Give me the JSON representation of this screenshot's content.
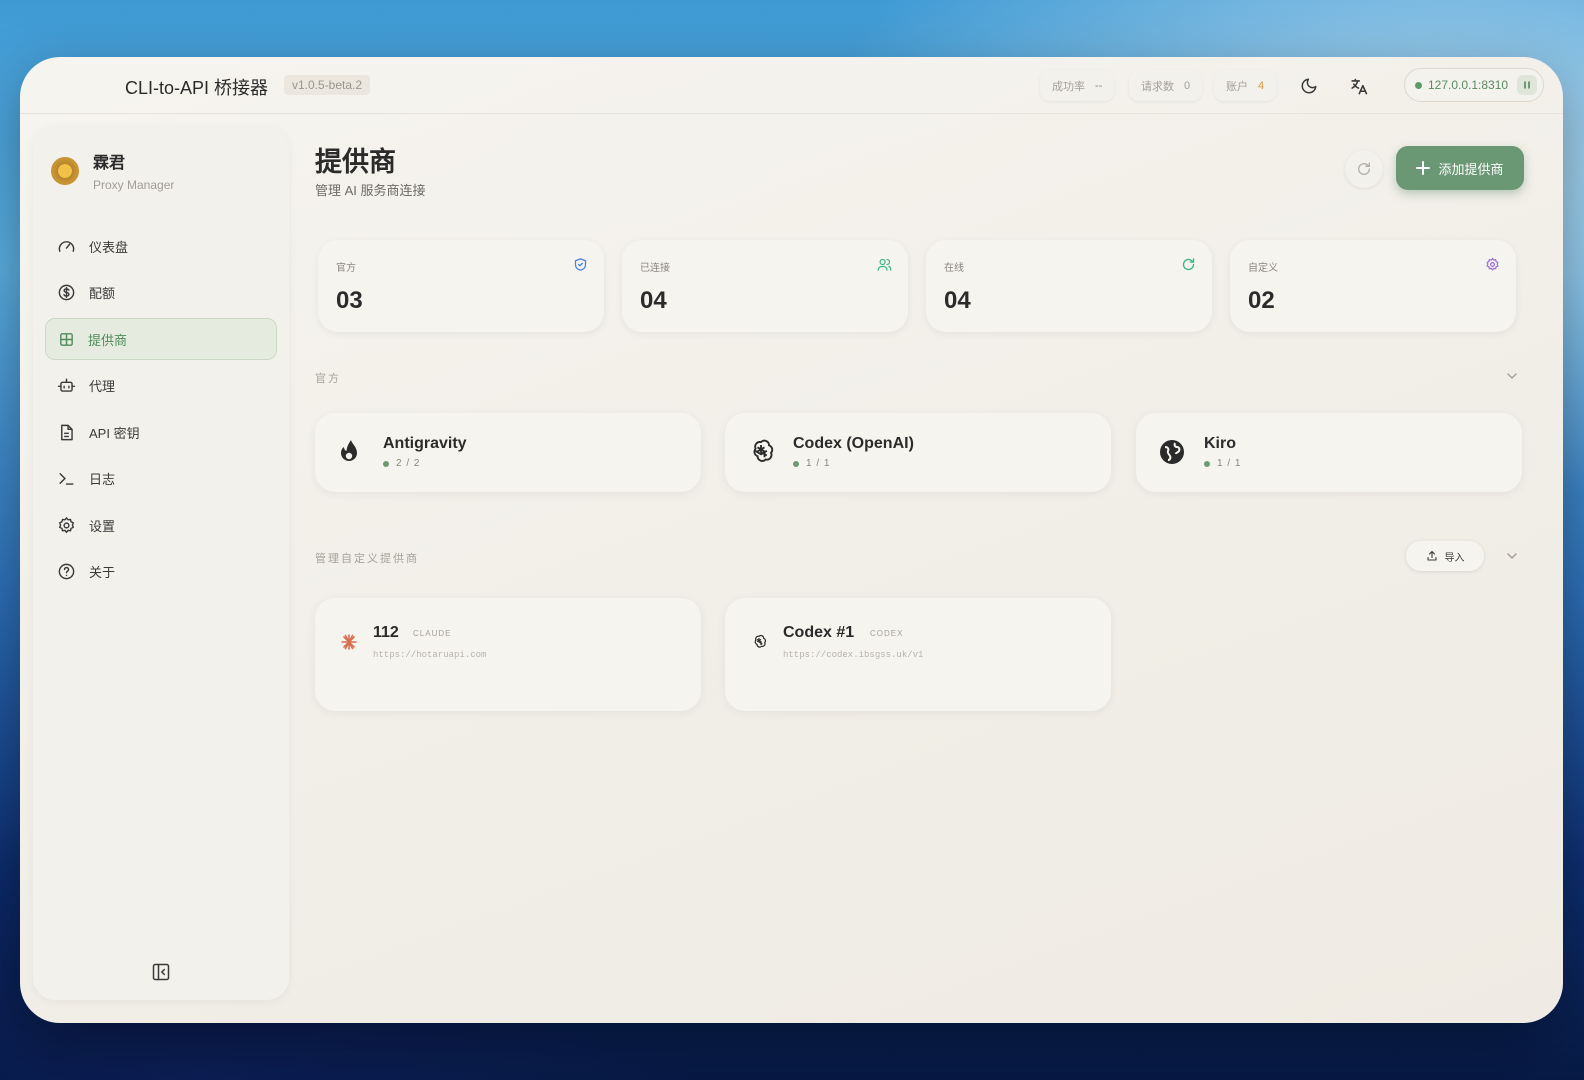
{
  "header": {
    "app_title": "CLI-to-API 桥接器",
    "version": "v1.0.5-beta.2",
    "stats": {
      "success_label": "成功率",
      "success_value": "--",
      "requests_label": "请求数",
      "requests_value": "0",
      "accounts_label": "账户",
      "accounts_value": "4"
    },
    "server": "127.0.0.1:8310"
  },
  "sidebar": {
    "brand_name": "霖君",
    "brand_sub": "Proxy Manager",
    "items": [
      {
        "label": "仪表盘",
        "icon": "gauge-icon"
      },
      {
        "label": "配额",
        "icon": "dollar-circle-icon"
      },
      {
        "label": "提供商",
        "icon": "grid-icon",
        "active": true
      },
      {
        "label": "代理",
        "icon": "bot-icon"
      },
      {
        "label": "API 密钥",
        "icon": "document-icon"
      },
      {
        "label": "日志",
        "icon": "terminal-icon"
      },
      {
        "label": "设置",
        "icon": "gear-icon"
      },
      {
        "label": "关于",
        "icon": "help-circle-icon"
      }
    ]
  },
  "main": {
    "title": "提供商",
    "subtitle": "管理 AI 服务商连接",
    "add_button": "添加提供商",
    "stats": [
      {
        "label": "官方",
        "value": "03",
        "icon": "shield-icon",
        "color": "#4a7fd9"
      },
      {
        "label": "已连接",
        "value": "04",
        "icon": "users-icon",
        "color": "#3fb58a"
      },
      {
        "label": "在线",
        "value": "04",
        "icon": "refresh-icon",
        "color": "#3fb58a"
      },
      {
        "label": "自定义",
        "value": "02",
        "icon": "gear-icon",
        "color": "#9b6fd6"
      }
    ],
    "official_section": "官方",
    "official_providers": [
      {
        "name": "Antigravity",
        "status": "2 / 2",
        "icon": "flame-icon"
      },
      {
        "name": "Codex (OpenAI)",
        "status": "1 / 1",
        "icon": "openai-icon"
      },
      {
        "name": "Kiro",
        "status": "1 / 1",
        "icon": "globe-icon"
      }
    ],
    "custom_section": "管理自定义提供商",
    "import_button": "导入",
    "custom_providers": [
      {
        "name": "112",
        "tag": "CLAUDE",
        "url": "https://hotaruapi.com",
        "icon": "claude-icon"
      },
      {
        "name": "Codex #1",
        "tag": "CODEX",
        "url": "https://codex.ibsgss.uk/v1",
        "icon": "openai-icon"
      }
    ]
  }
}
